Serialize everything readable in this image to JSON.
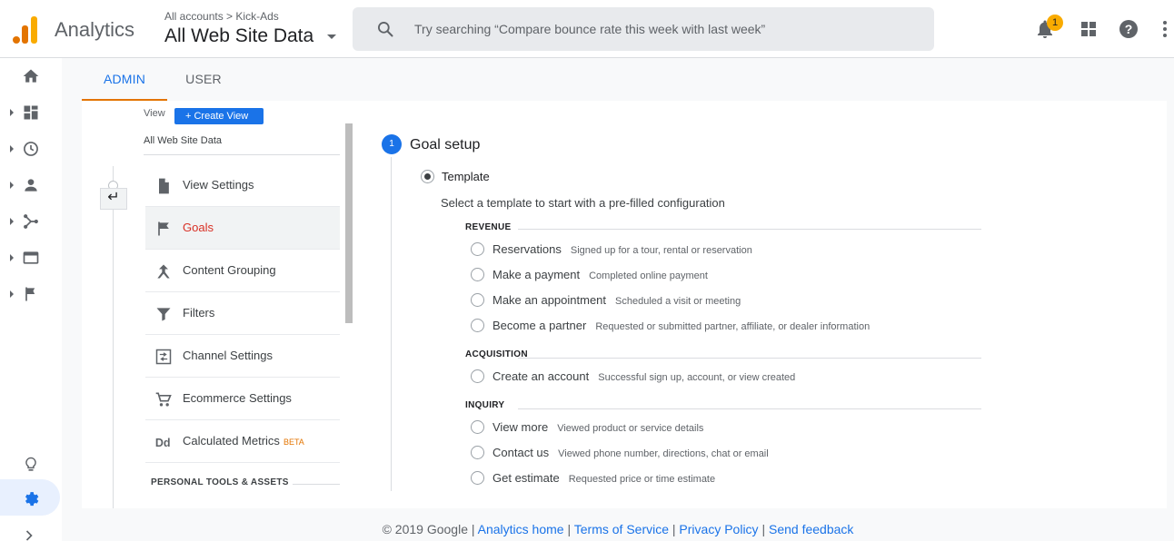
{
  "header": {
    "product_name": "Analytics",
    "breadcrumb_accounts": "All accounts",
    "breadcrumb_separator": ">",
    "breadcrumb_account": "Kick-Ads",
    "property_view": "All Web Site Data",
    "search_placeholder": "Try searching “Compare bounce rate this week with last week”",
    "notification_count": "1"
  },
  "tabs": {
    "admin": "ADMIN",
    "user": "USER"
  },
  "admin_column": {
    "view_label": "View",
    "create_view": "+ Create View",
    "view_name": "All Web Site Data",
    "back_glyph": "↵",
    "items": [
      {
        "label": "View Settings",
        "icon": "document-icon"
      },
      {
        "label": "Goals",
        "icon": "flag-icon"
      },
      {
        "label": "Content Grouping",
        "icon": "grouping-icon"
      },
      {
        "label": "Filters",
        "icon": "filter-icon"
      },
      {
        "label": "Channel Settings",
        "icon": "channel-icon"
      },
      {
        "label": "Ecommerce Settings",
        "icon": "cart-icon"
      },
      {
        "label": "Calculated Metrics",
        "icon": "dd-icon",
        "badge": "BETA"
      }
    ],
    "section_heading": "PERSONAL TOOLS & ASSETS"
  },
  "goal_setup": {
    "step_number": "1",
    "title": "Goal setup",
    "template_label": "Template",
    "template_desc": "Select a template to start with a pre-filled configuration",
    "categories": [
      {
        "name": "REVENUE",
        "options": [
          {
            "label": "Reservations",
            "desc": "Signed up for a tour, rental or reservation"
          },
          {
            "label": "Make a payment",
            "desc": "Completed online payment"
          },
          {
            "label": "Make an appointment",
            "desc": "Scheduled a visit or meeting"
          },
          {
            "label": "Become a partner",
            "desc": "Requested or submitted partner, affiliate, or dealer information"
          }
        ]
      },
      {
        "name": "ACQUISITION",
        "options": [
          {
            "label": "Create an account",
            "desc": "Successful sign up, account, or view created"
          }
        ]
      },
      {
        "name": "INQUIRY",
        "options": [
          {
            "label": "View more",
            "desc": "Viewed product or service details"
          },
          {
            "label": "Contact us",
            "desc": "Viewed phone number, directions, chat or email"
          },
          {
            "label": "Get estimate",
            "desc": "Requested price or time estimate"
          }
        ]
      }
    ]
  },
  "footer": {
    "copyright": "© 2019 Google",
    "sep": " | ",
    "links": [
      "Analytics home",
      "Terms of Service",
      "Privacy Policy",
      "Send feedback"
    ]
  },
  "colors": {
    "accent_blue": "#1a73e8",
    "accent_orange": "#e37400",
    "active_red": "#d93025",
    "badge_yellow": "#f9ab00"
  }
}
